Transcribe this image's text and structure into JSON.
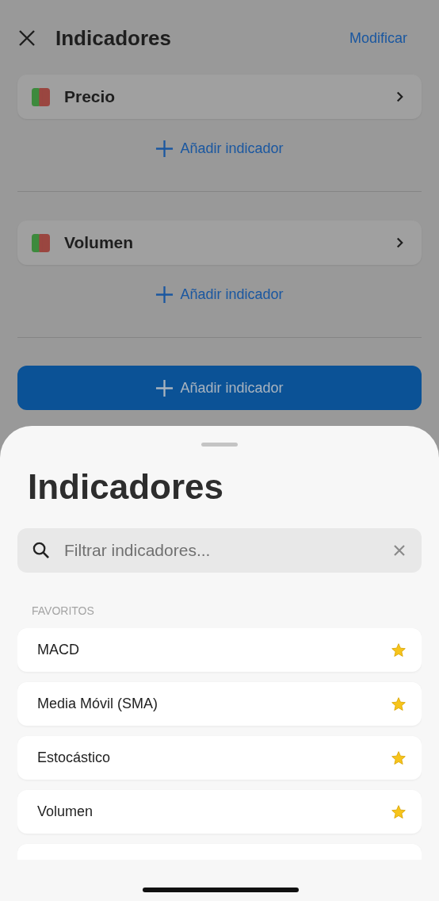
{
  "header": {
    "title": "Indicadores",
    "action": "Modificar"
  },
  "groups": [
    {
      "name": "Precio",
      "add_label": "Añadir indicador"
    },
    {
      "name": "Volumen",
      "add_label": "Añadir indicador"
    }
  ],
  "add_button": "Añadir indicador",
  "sheet": {
    "title": "Indicadores",
    "search": {
      "placeholder": "Filtrar indicadores..."
    },
    "section": "FAVORITOS",
    "items": [
      {
        "label": "MACD",
        "favorite": true
      },
      {
        "label": "Media Móvil (SMA)",
        "favorite": true
      },
      {
        "label": "Estocástico",
        "favorite": true
      },
      {
        "label": "Volumen",
        "favorite": true
      }
    ]
  }
}
